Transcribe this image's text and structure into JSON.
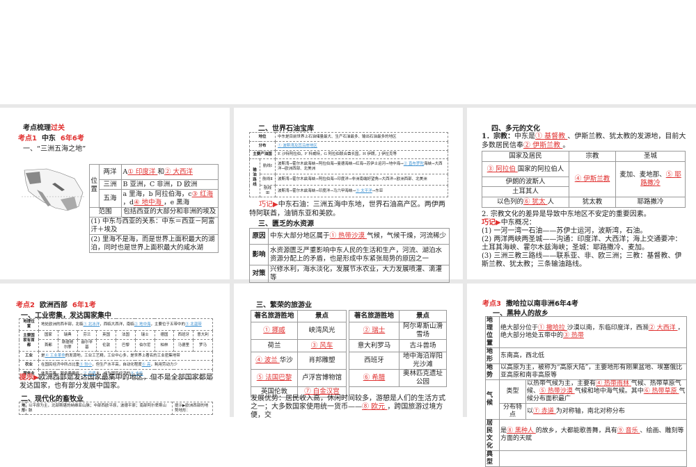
{
  "s1": {
    "title_a": "考点梳理",
    "title_b": "过关",
    "kd": "考点1",
    "kd_topic": "中东",
    "kd_freq": "6年6考",
    "sec1": "一、“三洲五海之地”",
    "loc": "位置",
    "ocean_lbl": "两洋",
    "ocean_a": "A",
    "ocean_1": "①  印度洋 ",
    "ocean_and": " 和",
    "ocean_2": "②  大西洋 ",
    "cont_lbl": "三洲",
    "cont_txt": "B 亚洲，C 非洲，D 欧洲",
    "sea_lbl": "五海",
    "sea_txt1": "a 里海，b 阿拉伯海，c",
    "sea_3": "③  红海 ",
    "sea_txt2": "，d",
    "sea_4": "④  地中海 ",
    "sea_txt3": "，e 黑海",
    "range_lbl": "范围",
    "range_txt": "包括西亚的大部分和非洲的埃及",
    "note1": "(1) 中东与西亚的关系：中东＝西亚－阿富汗＋埃及",
    "note2": "(2) 里海不是海，而是世界上面积最大的湖泊，同时也是世界上面积最大的咸水湖"
  },
  "s2": {
    "sec2": "二、世界石油宝库",
    "r_pos": "地位",
    "r_pos_txt": "中东是目前世界上石油储量最大、生产石油最多、输出石油最多的地区",
    "r_dist": "分布",
    "r_dist_ans": "① 波斯湾及其沿岸地区",
    "r_prod": "主要产油国",
    "r_prod_txt": "E 沙特阿拉伯，F 科威特，G 阿拉伯联合酋长国，H 伊朗，J 伊拉克等",
    "r_route": "输油路线",
    "l1": "航线Ⅰ",
    "l1_a": "波斯湾→霍尔木兹海峡→阿拉伯海→曼德海峡→红海→苏伊士运河→地中海→",
    "l1_ans": "② 直布罗陀",
    "l1_b": "海峡→大西洋→欧洲西部、北美洲",
    "l2": "航线Ⅱ",
    "l2_txt": "波斯湾→霍尔木兹海峡→阿拉伯海→印度洋→非洲南端好望角→大西洋→欧洲西部、北美洲",
    "l3": "航线Ⅲ",
    "l3_a": "波斯湾→霍尔木兹海峡→印度洋→马六甲海峡→",
    "l3_ans": "③ 太平洋",
    "l3_b": "→东亚",
    "tip_lbl": "巧记▶",
    "tip_txt": "中东石油：三洲五海中东地，世界石油高产区。两伊两特阿联酋，油销东亚和美欧。",
    "sec3": "三、匮乏的水资源",
    "cause": "原因",
    "cause_a": "中东大部分地区属于",
    "cause_ans": "①  热带沙漠 ",
    "cause_b": "气候，气候干燥，河流稀少",
    "effect": "影响",
    "effect_txt": "水资源匮乏严重影响中东人民的生活和生产，河流、湖泊水资源分配上的矛盾，也是形成中东紧张局势的原因之一",
    "measure": "对策",
    "measure_txt": "兴修水利，海水淡化，发展节水农业，大力发展喷灌、滴灌等"
  },
  "s3": {
    "sec4": "四、多元的文化",
    "p1_a": "1．宗教：",
    "p1_b": "中东是",
    "p1_ans1": "① 基督教 ",
    "p1_c": "、伊斯兰教、犹太教的发源地，目前大多数居民信奉",
    "p1_ans2": "② 伊斯兰教 ",
    "p1_d": "。",
    "th1": "国家及居民",
    "th2": "宗教",
    "th3": "圣城",
    "r1_ans": "③  阿拉伯 ",
    "r1_txt": "国家的阿拉伯人",
    "r2": "伊朗的波斯人",
    "r3": "土耳其人",
    "rel_ans": "④ 伊斯兰教 ",
    "city_a": "麦加、麦地那、",
    "city_ans": "⑤  耶路撒冷 ",
    "r4_a": "以色列的",
    "r4_ans": "⑥  犹太 ",
    "r4_b": "人",
    "r4_rel": "犹太教",
    "r4_city": "耶路撒冷",
    "p2": "2. 宗教文化的差异是导致中东地区不安定的重要因素。",
    "tip_lbl": "巧记▶",
    "tip_txt": "中东概况：",
    "t1": "(1) 一河一湾一石油——苏伊士运河，波斯湾，石油。",
    "t2": "(2) 两洋两峡两圣城——沟通：印度洋、大西洋；海上交通要冲：土耳其海峡、霍尔木兹海峡；圣城：耶路撒冷、麦加。",
    "t3": "(3) 三洲三教三路线——联系亚、非、欧三洲；三教：基督教、伊斯兰教、犹太教；三条输油路线。"
  },
  "s4": {
    "kd": "考点2",
    "kd_topic": "欧洲西部",
    "kd_freq": "6年1考",
    "sec1": "一、工业密集，发达国家集中",
    "geo": "地理位置",
    "geo_a": "地处欧洲的西半部，北临",
    "geo_1": "① 北冰洋",
    "geo_b": "，西临大西洋，南临",
    "geo_2": "② 地中海",
    "geo_c": "，主要位于五带中的",
    "geo_3": "③ 北温带",
    "cap": "主要国家有首都",
    "countries": [
      "国家",
      "瑞典",
      "芬兰",
      "英国",
      "法国",
      "瑞士",
      "德国",
      "西班牙",
      "意大利"
    ],
    "capitals": [
      "首都",
      "斯德哥尔摩",
      "赫尔辛基",
      "伦敦",
      "巴黎",
      "伯尔尼",
      "柏林",
      "马德里",
      "罗马"
    ],
    "ind": "工业",
    "ind_a": "是",
    "ind_ans": "④ 工业革命",
    "ind_b": "的发源地，工业工艺精，工业中心多，是世界上著名的工业密集地带",
    "agr": "农业",
    "agr_a": "在国民经济中所占比重",
    "agr_ans1": "⑤ 较小",
    "agr_b": "，但生产水平高，自动化程度",
    "agr_ans2": "⑥ 高",
    "agr_c": "，耗用劳动力少",
    "srv": "服务业",
    "srv_a": "体系完善，服务质量优，",
    "srv_ans1": "⑦ 产值",
    "srv_b": "大，成为国民经济的",
    "srv_ans2": "⑧ 支柱",
    "tip_lbl": "提示▶",
    "tip_txt": "欧洲西部是发达国家最集中的地区，但不是全部国家都是发达国家，也有部分发展中国家。",
    "sec2": "二、现代化的畜牧业",
    "terrain": "地形",
    "terrain_txt": "以平原为主，北部斯堪的纳维亚山脉；中部西欧平原，波德平原；南部阿尔卑斯山脉",
    "hint": "提示▶欧洲西部的地势地形："
  },
  "s5": {
    "sec3": "三、繁荣的旅游业",
    "h1": "著名旅游胜地",
    "h2": "景点",
    "h3": "著名旅游胜地",
    "h4": "景点",
    "l": [
      {
        "a": "① 挪威 ",
        "b": "峡湾风光"
      },
      {
        "a": "荷兰",
        "bans": "③ 风车 "
      },
      {
        "aans": "④ 波兰 ",
        "a2": "华沙",
        "b": "肖邦雕塑"
      },
      {
        "aans": "⑤ 法国巴黎 ",
        "b": "卢浮宫博物馆"
      },
      {
        "a": "英国伦敦",
        "bans": "⑦  白金汉宫 "
      }
    ],
    "r": [
      {
        "aans": "② 瑞士 ",
        "b": "阿尔卑斯山滑雪场"
      },
      {
        "a": "意大利罗马",
        "b": "古斗兽场"
      },
      {
        "a": "西班牙",
        "b": "地中海沿岸阳光沙滩"
      },
      {
        "aans": "⑥ 希腊 ",
        "b": "奥林匹克遗址公园"
      }
    ],
    "adv_a": "发展优势：居民收入高，休闲时间较多，游憩是人们的生活方式之一；大多数国家使用统一货币——",
    "adv_ans": "⑧  欧元 ",
    "adv_b": "，跨国旅游过境方便，交"
  },
  "s6": {
    "kd": "考点3",
    "kd_topic": "撒哈拉以南非洲",
    "kd_freq": "6年4考",
    "sec1": "一、黑种人的故乡",
    "geo": "地理位置",
    "geo_a": "绝大部分位于",
    "geo_1": "①  撒哈拉 ",
    "geo_b": "沙漠以南，东临印度洋，西濒",
    "geo_2": "②  大西洋 ",
    "geo_c": "，绝大部分地处五带中的",
    "geo_3": "③  热带 ",
    "landform": "地形",
    "landform_txt": "东南高，西北低",
    "relief": "地势",
    "relief_txt": "以高原为主，被称为“高原大陆”，主要地形有刚果盆地、埃塞俄比亚高原和南非高原等",
    "climate": "气候",
    "type": "类型",
    "type_a": "以热带气候为主，主要有",
    "type_4": "④  热带雨林 ",
    "type_b": "气候、热带草原气候、",
    "type_5": "⑤  热带沙漠 ",
    "type_c": "气候和地中海气候。其中",
    "type_6": "⑥  热带草原 ",
    "type_d": "气候分布面积最广",
    "dist": "分布特点",
    "dist_a": "以",
    "dist_7": "⑦  赤道 ",
    "dist_b": "为对称轴，南北对称分布",
    "people": "居民文化",
    "people_a": "是",
    "people_8": "⑧  黑种人 ",
    "people_b": "的故乡，大都能歌善舞，具有",
    "people_9": "⑨  音乐 ",
    "people_c": "、绘画、雕刻等方面的天赋",
    "typical": "典型"
  }
}
